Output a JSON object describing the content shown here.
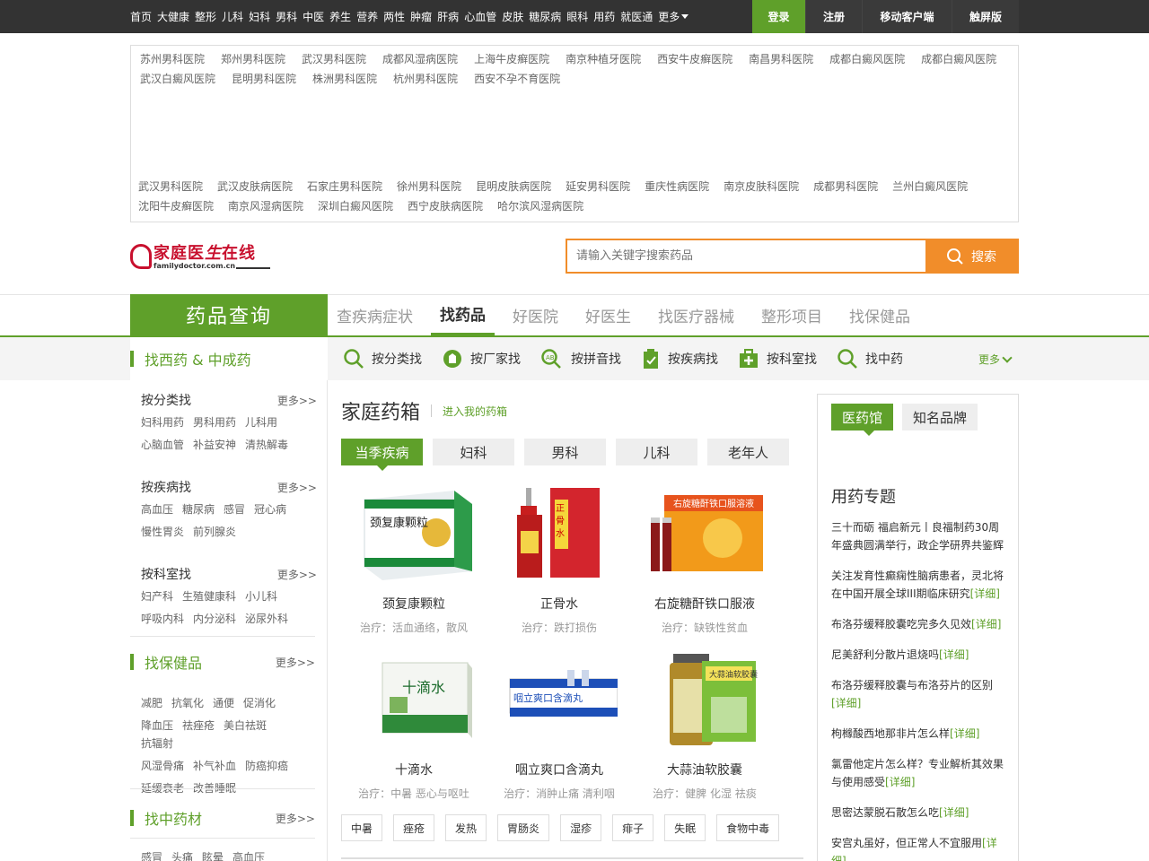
{
  "topnav": {
    "items": [
      "首页",
      "大健康",
      "整形",
      "儿科",
      "妇科",
      "男科",
      "中医",
      "养生",
      "营养",
      "两性",
      "肿瘤",
      "肝病",
      "心血管",
      "皮肤",
      "糖尿病",
      "眼科",
      "用药",
      "就医通"
    ],
    "more": "更多",
    "login": "登录",
    "register": "注册",
    "mobile": "移动客户端",
    "touch": "触屏版"
  },
  "hospitals": {
    "row1": [
      "苏州男科医院",
      "郑州男科医院",
      "武汉男科医院",
      "成都风湿病医院",
      "上海牛皮癣医院",
      "南京种植牙医院",
      "西安牛皮癣医院",
      "南昌男科医院",
      "成都白癜风医院",
      "成都白癜风医院",
      "武汉白癜风医院",
      "昆明男科医院",
      "株洲男科医院",
      "杭州男科医院",
      "西安不孕不育医院"
    ],
    "row2": [
      "武汉男科医院",
      "武汉皮肤病医院",
      "石家庄男科医院",
      "徐州男科医院",
      "昆明皮肤病医院",
      "延安男科医院",
      "重庆性病医院",
      "南京皮肤科医院",
      "成都男科医院",
      "兰州白癜风医院",
      "沈阳牛皮癣医院",
      "南京风湿病医院",
      "深圳白癜风医院",
      "西宁皮肤病医院",
      "哈尔滨风湿病医院"
    ]
  },
  "logo": {
    "cn_a": "家庭医",
    "cn_b": "生",
    "cn_c": "在线",
    "en": "familydoctor.com.cn"
  },
  "search": {
    "placeholder": "请输入关键字搜索药品",
    "button": "搜索"
  },
  "mainnav": {
    "title": "药品查询",
    "items": [
      "查疾病症状",
      "找药品",
      "好医院",
      "好医生",
      "找医疗器械",
      "整形项目",
      "找保健品"
    ]
  },
  "subnav": {
    "left_title": "找西药 & 中成药",
    "items": [
      "按分类找",
      "按厂家找",
      "按拼音找",
      "按疾病找",
      "按科室找",
      "找中药"
    ],
    "more": "更多"
  },
  "sidebar": {
    "more": "更多>>",
    "blocks": [
      {
        "title": "按分类找",
        "rows": [
          [
            "妇科用药",
            "男科用药",
            "儿科用"
          ],
          [
            "心脑血管",
            "补益安神",
            "清热解毒"
          ]
        ]
      },
      {
        "title": "按疾病找",
        "rows": [
          [
            "高血压",
            "糖尿病",
            "感冒",
            "冠心病"
          ],
          [
            "慢性胃炎",
            "前列腺炎"
          ]
        ]
      },
      {
        "title": "按科室找",
        "rows": [
          [
            "妇产科",
            "生殖健康科",
            "小儿科"
          ],
          [
            "呼吸内科",
            "内分泌科",
            "泌尿外科"
          ]
        ]
      }
    ],
    "health_title": "找保健品",
    "health_rows": [
      [
        "减肥",
        "抗氧化",
        "通便",
        "促消化"
      ],
      [
        "降血压",
        "祛痤疮",
        "美白祛斑",
        "抗辐射"
      ],
      [
        "风湿骨痛",
        "补气补血",
        "防癌抑癌"
      ],
      [
        "延缓衰老",
        "改善睡眠"
      ]
    ],
    "herb_title": "找中药材",
    "herb_row": [
      "感冒",
      "头痛",
      "眩晕",
      "高血压"
    ]
  },
  "medbox": {
    "title": "家庭药箱",
    "link": "进入我的药箱",
    "tabs": [
      "当季疾病",
      "妇科",
      "男科",
      "儿科",
      "老年人"
    ],
    "products": [
      {
        "name": "颈复康颗粒",
        "desc": "治疗：活血通络，散风"
      },
      {
        "name": "正骨水",
        "desc": "治疗：跌打损伤"
      },
      {
        "name": "右旋糖酐铁口服液",
        "desc": "治疗：缺铁性贫血"
      },
      {
        "name": "十滴水",
        "desc": "治疗：中暑 恶心与呕吐"
      },
      {
        "name": "咽立爽口含滴丸",
        "desc": "治疗：消肿止痛 清利咽"
      },
      {
        "name": "大蒜油软胶囊",
        "desc": "治疗：健脾 化湿 祛痰"
      }
    ],
    "tags": [
      "中暑",
      "痤疮",
      "发热",
      "胃肠炎",
      "湿疹",
      "痱子",
      "失眠",
      "食物中毒"
    ]
  },
  "rightbox": {
    "tabs": [
      "医药馆",
      "知名品牌"
    ],
    "title": "用药专题",
    "detail": "[详细]",
    "items": [
      {
        "text": "三十而砺 福启新元丨良福制药30周年盛典圆满举行，政企学研界共鉴辉",
        "detail": ""
      },
      {
        "text": "关注发育性癫痫性脑病患者，灵北将在中国开展全球III期临床研究",
        "detail": "[详细]"
      },
      {
        "text": "布洛芬缓释胶囊吃完多久见效",
        "detail": "[详细]"
      },
      {
        "text": "尼美舒利分散片退烧吗",
        "detail": "[详细]"
      },
      {
        "text": "布洛芬缓释胶囊与布洛芬片的区别",
        "detail": "[详细]"
      },
      {
        "text": "枸橼酸西地那非片怎么样",
        "detail": "[详细]"
      },
      {
        "text": "氯雷他定片怎么样？专业解析其效果与使用感受",
        "detail": "[详细]"
      },
      {
        "text": "思密达蒙脱石散怎么吃",
        "detail": "[详细]"
      },
      {
        "text": "安宫丸虽好，但正常人不宜服用",
        "detail": "[详细]"
      }
    ]
  },
  "colors": {
    "green": "#5fa02a",
    "orange": "#f18d2a",
    "topbar": "#333333"
  }
}
